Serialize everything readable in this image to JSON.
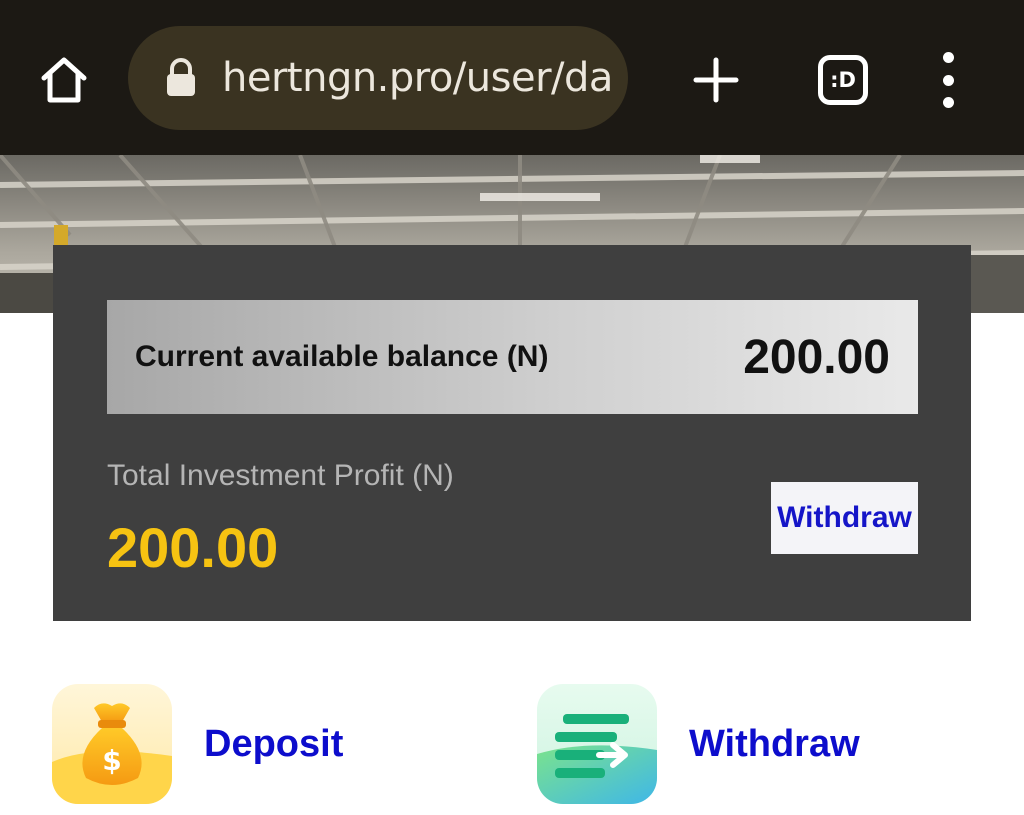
{
  "browser": {
    "url": "hertngn.pro/user/da",
    "tabs_label": ":D"
  },
  "icons": {
    "home": "home-icon",
    "lock": "lock-icon",
    "new_tab": "plus-icon",
    "tabs": "tabs-switcher-icon",
    "menu": "more-vert-icon",
    "deposit": "money-bag-icon",
    "withdraw": "transfer-arrow-icon"
  },
  "card": {
    "balance_label": "Current available balance (N)",
    "balance_value": "200.00",
    "profit_label": "Total Investment Profit (N)",
    "profit_value": "200.00",
    "withdraw_label": "Withdraw"
  },
  "actions": {
    "deposit_label": "Deposit",
    "withdraw_label": "Withdraw"
  },
  "colors": {
    "browser_bar": "#1c1914",
    "card_bg": "#3f3f3f",
    "profit_accent": "#f6c312",
    "link_blue": "#0d0dcc"
  }
}
